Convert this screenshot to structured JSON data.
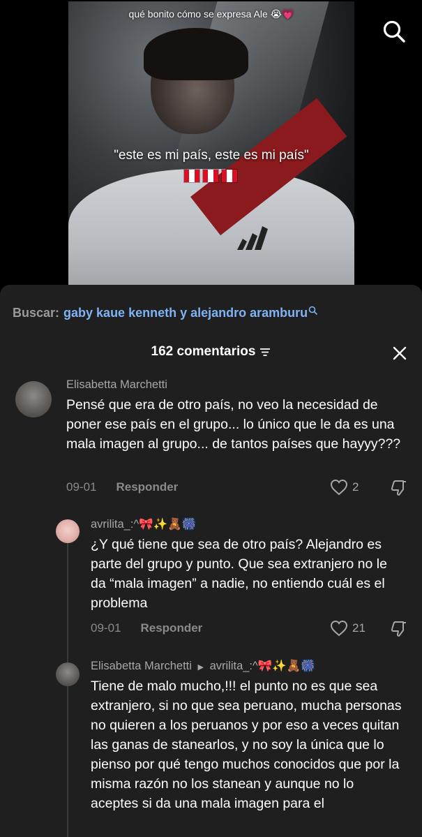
{
  "video": {
    "overlay_top": "qué bonito cómo se expresa Ale 😭💗",
    "overlay_caption": "\"este es mi país, este es mi país\""
  },
  "search": {
    "label": "Buscar:",
    "query": "gaby kaue kenneth y alejandro aramburu"
  },
  "comments_header": {
    "title": "162 comentarios"
  },
  "comments": [
    {
      "username": "Elisabetta Marchetti",
      "text": "Pensé que era de otro país, no veo la necesidad de poner ese país en el grupo... lo único que le da es una mala imagen al grupo... de tantos países que hayyy???",
      "date": "09-01",
      "reply_label": "Responder",
      "likes": "2"
    },
    {
      "username": "avrilita_:^🎀✨🧸🎆",
      "text": "¿Y qué tiene que sea de otro país? Alejandro es parte del grupo y punto. Que sea extranjero no le da “mala imagen” a nadie, no entiendo cuál es el problema",
      "date": "09-01",
      "reply_label": "Responder",
      "likes": "21"
    },
    {
      "username": "Elisabetta Marchetti",
      "reply_to": "avrilita_:^🎀✨🧸🎆",
      "text": "Tiene de malo mucho,!!! el punto no es que sea extranjero, si no que sea peruano, mucha personas no quieren a los peruanos y por eso a veces quitan las ganas de stanearlos, y no soy la única que lo pienso por qué tengo muchos conocidos que por la misma razón no los stanean y aunque no lo aceptes si da una mala imagen para el"
    }
  ],
  "colors": {
    "panel_bg": "#1f1f1f",
    "search_query": "#7fb3f4",
    "peru_red": "#d91023"
  }
}
